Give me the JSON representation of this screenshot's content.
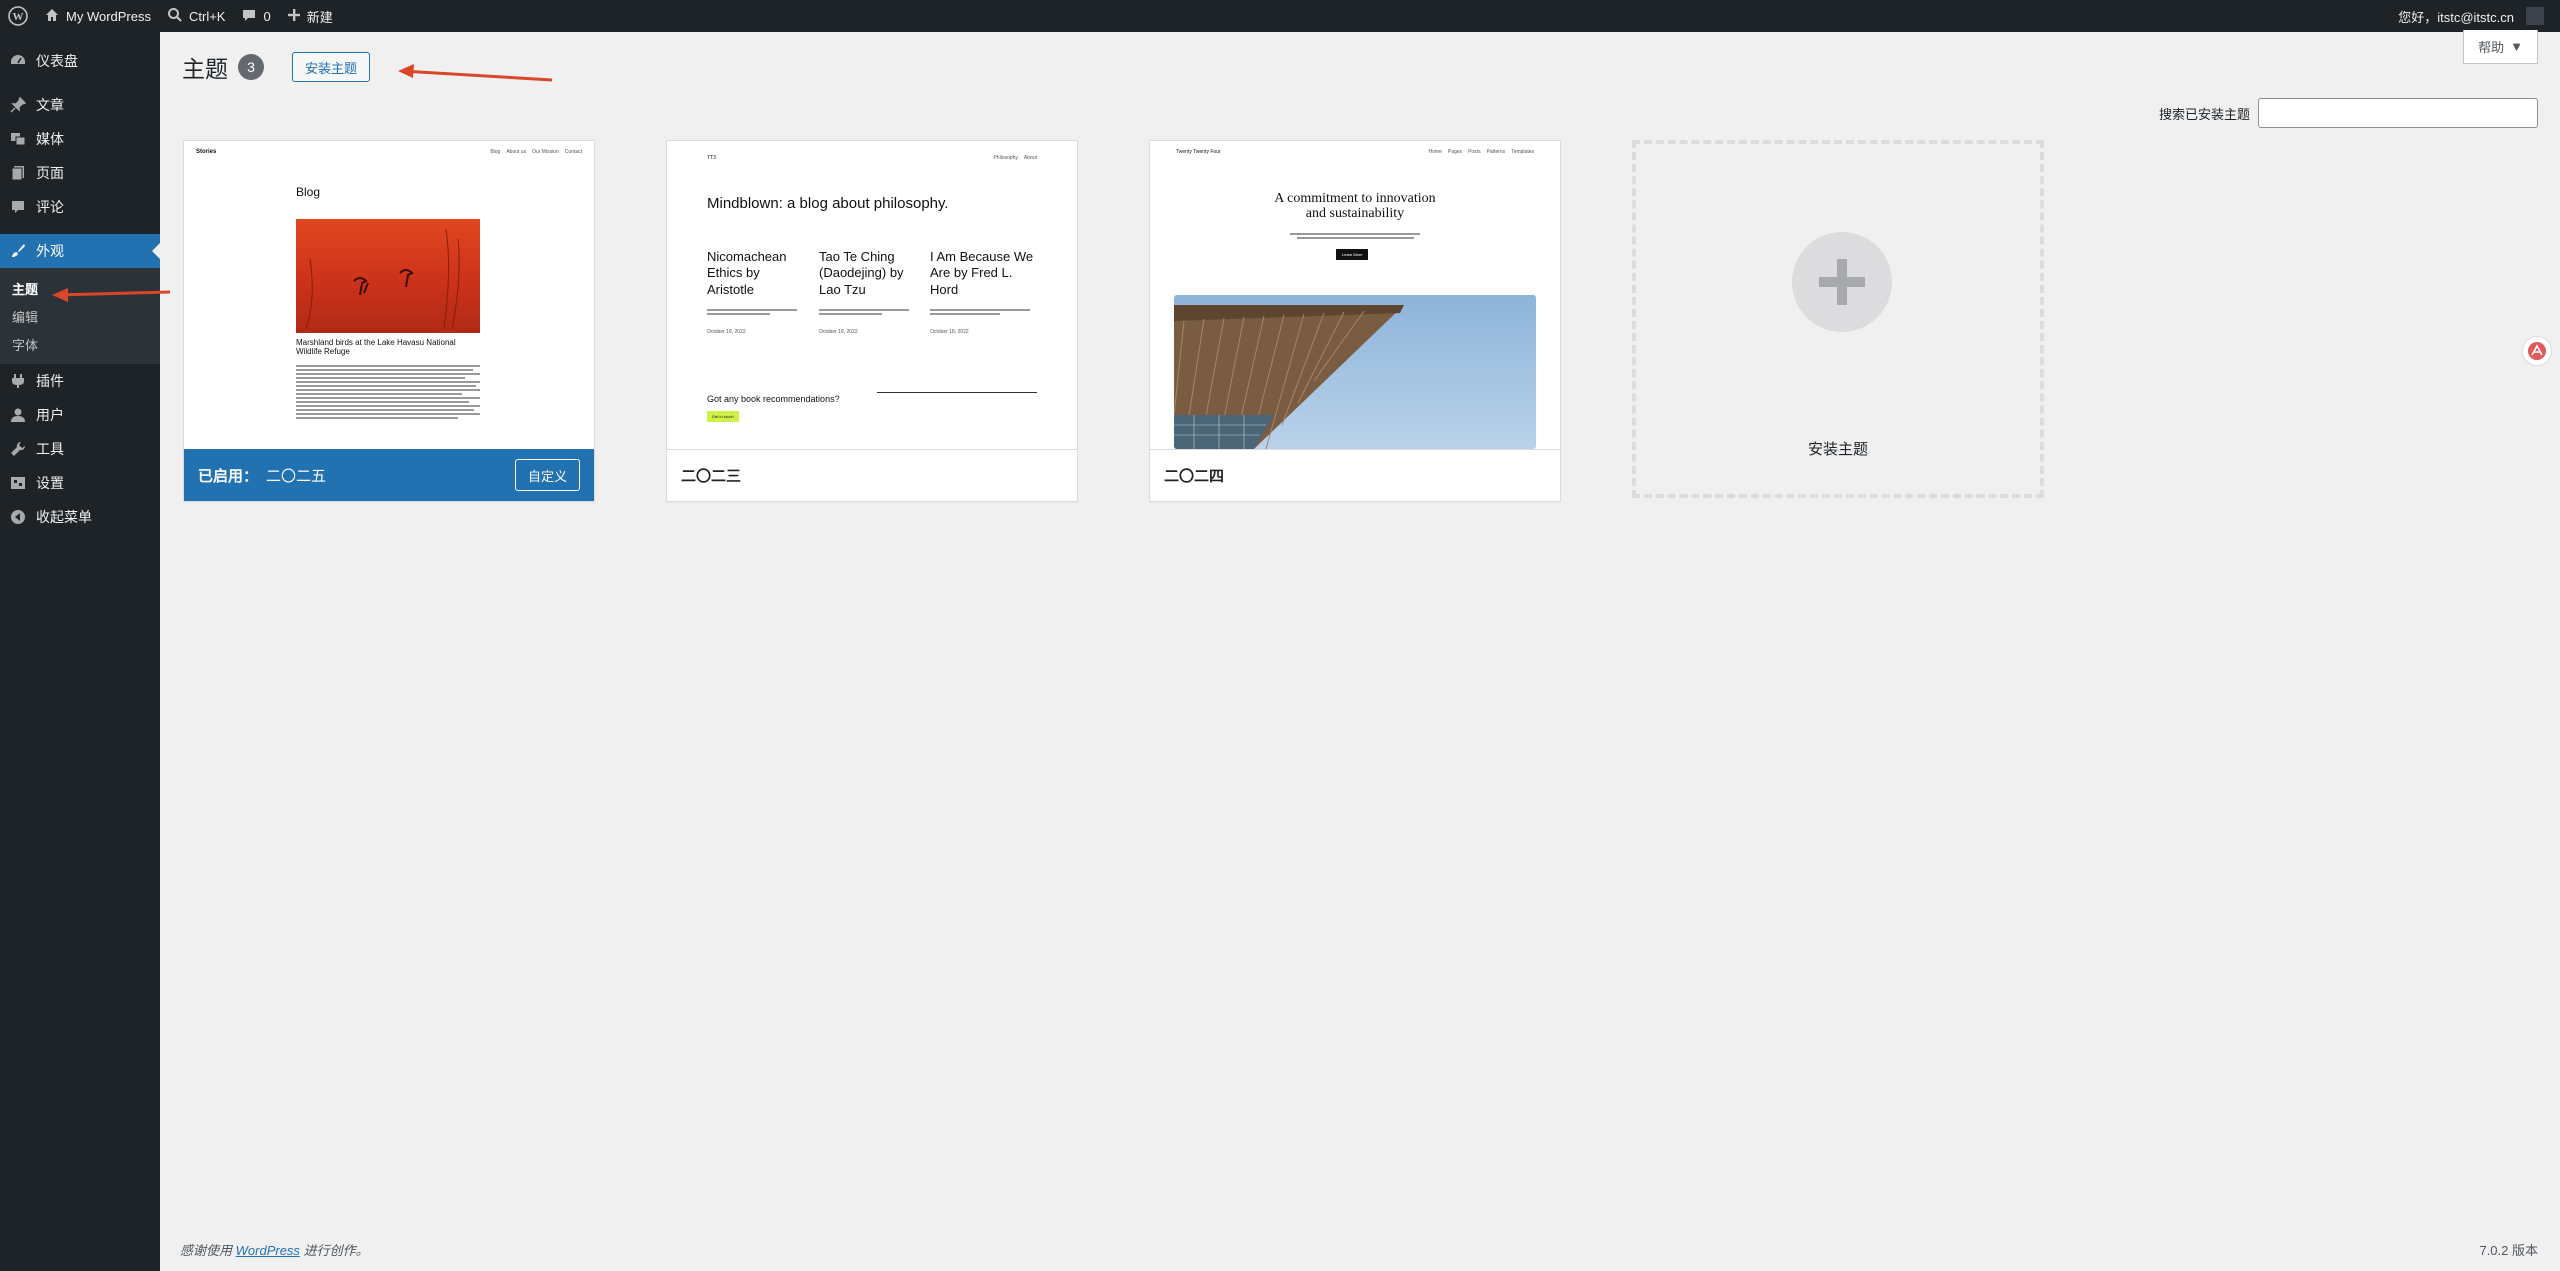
{
  "adminbar": {
    "site_name": "My WordPress",
    "shortcut": "Ctrl+K",
    "comments_count": "0",
    "new_label": "新建",
    "greeting": "您好，itstc@itstc.cn"
  },
  "sidebar": {
    "items": [
      {
        "label": "仪表盘",
        "icon": "dashboard-icon"
      },
      {
        "label": "文章",
        "icon": "pin-icon"
      },
      {
        "label": "媒体",
        "icon": "media-icon"
      },
      {
        "label": "页面",
        "icon": "page-icon"
      },
      {
        "label": "评论",
        "icon": "comment-icon"
      },
      {
        "label": "外观",
        "icon": "paintbrush-icon"
      },
      {
        "label": "插件",
        "icon": "plugin-icon"
      },
      {
        "label": "用户",
        "icon": "user-icon"
      },
      {
        "label": "工具",
        "icon": "wrench-icon"
      },
      {
        "label": "设置",
        "icon": "settings-icon"
      },
      {
        "label": "收起菜单",
        "icon": "collapse-icon"
      }
    ],
    "appearance_sub": [
      "主题",
      "编辑",
      "字体"
    ]
  },
  "header": {
    "title": "主题",
    "count": "3",
    "add_new": "安装主题",
    "help": "帮助",
    "search_label": "搜索已安装主题"
  },
  "themes": [
    {
      "name": "二〇二五",
      "active_label": "已启用：",
      "customize": "自定义",
      "preview": {
        "site": "Stories",
        "nav": [
          "Blog",
          "About us",
          "Our Mission",
          "Contact"
        ],
        "heading": "Blog",
        "caption": "Marshland birds at the Lake Havasu National Wildlife Refuge"
      }
    },
    {
      "name": "二〇二三",
      "preview": {
        "site": "TT3",
        "nav": [
          "Philosophy",
          "About"
        ],
        "heading": "Mindblown: a blog about philosophy.",
        "posts": [
          "Nicomachean Ethics by Aristotle",
          "Tao Te Ching (Daodejing) by Lao Tzu",
          "I Am Because We Are by Fred L. Hord"
        ],
        "dates": [
          "October 18, 2022",
          "October 18, 2022",
          "October 18, 2022"
        ],
        "cta": "Got any book recommendations?",
        "cta_btn": "Get in touch"
      }
    },
    {
      "name": "二〇二四",
      "preview": {
        "site": "Twenty Twenty Four",
        "nav": [
          "Home",
          "Pages",
          "Posts",
          "Patterns",
          "Templates"
        ],
        "heading_line1": "A commitment to innovation",
        "heading_line2": "and sustainability",
        "btn": "Learn More"
      }
    }
  ],
  "add_theme_label": "安装主题",
  "footer": {
    "thanks_prefix": "感谢使用",
    "thanks_link": "WordPress",
    "thanks_suffix": "进行创作。",
    "version": "7.0.2 版本"
  }
}
